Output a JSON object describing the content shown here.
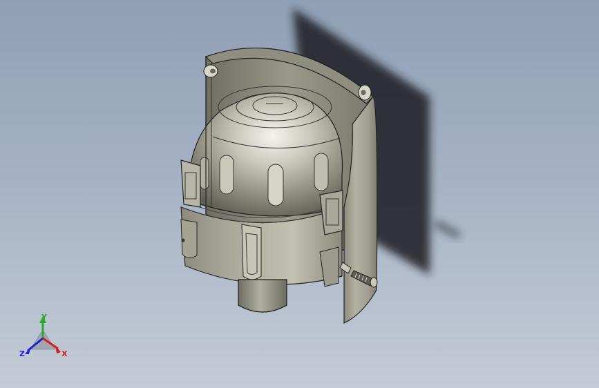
{
  "viewport": {
    "background_top": "#8f9fb5",
    "background_bottom": "#c4cbd6",
    "model_color": "#a9a899"
  },
  "triad": {
    "x_label": "X",
    "y_label": "Y",
    "z_label": "Z",
    "x_color": "#d42020",
    "y_color": "#2ea82e",
    "z_color": "#2020d4"
  }
}
